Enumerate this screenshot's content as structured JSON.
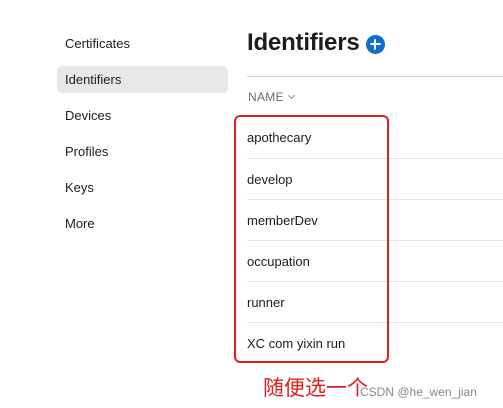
{
  "sidebar": {
    "items": [
      {
        "label": "Certificates"
      },
      {
        "label": "Identifiers"
      },
      {
        "label": "Devices"
      },
      {
        "label": "Profiles"
      },
      {
        "label": "Keys"
      },
      {
        "label": "More"
      }
    ],
    "active_index": 1
  },
  "main": {
    "title": "Identifiers",
    "add_icon": "plus-circle-icon",
    "column_header": "NAME",
    "rows": [
      {
        "name": "apothecary"
      },
      {
        "name": "develop"
      },
      {
        "name": "memberDev"
      },
      {
        "name": "occupation"
      },
      {
        "name": "runner"
      },
      {
        "name": "XC com yixin run"
      }
    ]
  },
  "annotation": {
    "text": "随便选一个",
    "color": "#e02020"
  },
  "watermark": "CSDN @he_wen_jian",
  "colors": {
    "accent": "#0a6fd1",
    "active_bg": "#e8e8ea",
    "annotation": "#e02020"
  }
}
